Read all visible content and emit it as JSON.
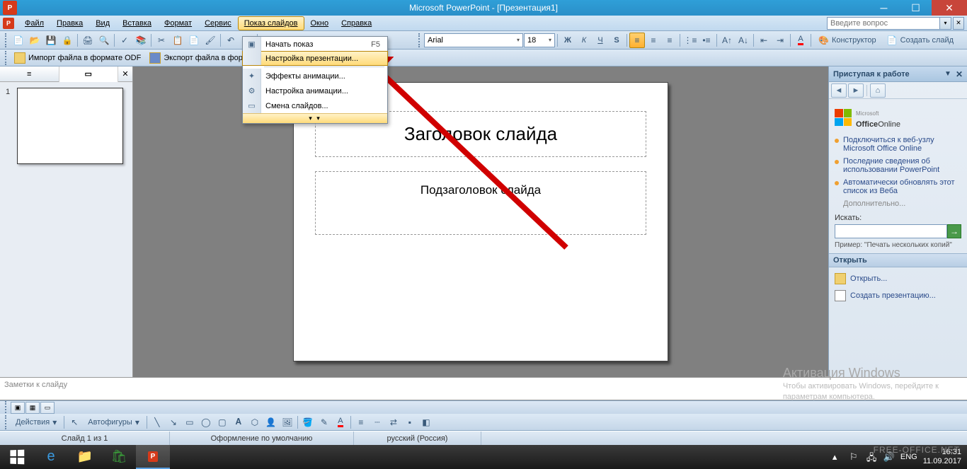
{
  "title": "Microsoft PowerPoint - [Презентация1]",
  "menu": {
    "file": "Файл",
    "edit": "Правка",
    "view": "Вид",
    "insert": "Вставка",
    "format": "Формат",
    "tools": "Сервис",
    "slideshow": "Показ слайдов",
    "window": "Окно",
    "help": "Справка"
  },
  "help_placeholder": "Введите вопрос",
  "odf": {
    "import": "Импорт файла в формате ODF",
    "export": "Экспорт файла в формате ODF"
  },
  "font": {
    "name": "Arial",
    "size": "18"
  },
  "designer_label": "Конструктор",
  "new_slide_label": "Создать слайд",
  "dropdown": {
    "start": "Начать показ",
    "start_key": "F5",
    "setup": "Настройка презентации...",
    "effects": "Эффекты анимации...",
    "anim": "Настройка анимации...",
    "transition": "Смена слайдов..."
  },
  "slide": {
    "num": "1",
    "title": "Заголовок слайда",
    "subtitle": "Подзаголовок слайда"
  },
  "notes_placeholder": "Заметки к слайду",
  "taskpane": {
    "header": "Приступая к работе",
    "office": "Office",
    "online": "Online",
    "ms": "Microsoft",
    "link1": "Подключиться к веб-узлу Microsoft Office Online",
    "link2": "Последние сведения об использовании PowerPoint",
    "link3": "Автоматически обновлять этот список из Веба",
    "more": "Дополнительно...",
    "search_label": "Искать:",
    "example": "Пример:  \"Печать нескольких копий\"",
    "open_section": "Открыть",
    "open": "Открыть...",
    "create": "Создать презентацию..."
  },
  "watermark": {
    "title": "Активация Windows",
    "line1": "Чтобы активировать Windows, перейдите к",
    "line2": "параметрам компьютера."
  },
  "draw": {
    "actions": "Действия",
    "autoshapes": "Автофигуры"
  },
  "status": {
    "slide": "Слайд 1 из 1",
    "design": "Оформление по умолчанию",
    "lang": "русский (Россия)"
  },
  "tray": {
    "lang": "ENG",
    "time": "16:31",
    "date": "11.09.2017",
    "corner": "FREE-OFFICE.NET"
  }
}
